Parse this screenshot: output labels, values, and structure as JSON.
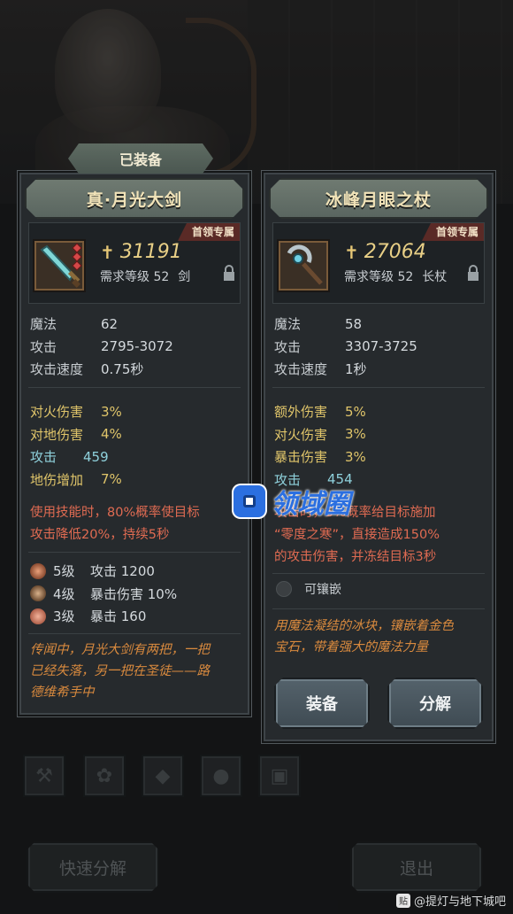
{
  "equipped_tab": "已装备",
  "left_item": {
    "title": "真·月光大剑",
    "boss_tag": "首领专属",
    "power": "31191",
    "req_level": "需求等级 52",
    "weapon_type": "剑",
    "base_stats": [
      {
        "key": "魔法",
        "value": "62"
      },
      {
        "key": "攻击",
        "value": "2795-3072"
      },
      {
        "key": "攻击速度",
        "value": "0.75秒"
      }
    ],
    "bonus_stats": [
      {
        "key": "对火伤害",
        "value": "3%"
      },
      {
        "key": "对地伤害",
        "value": "4%"
      }
    ],
    "cyan_stat": {
      "key": "攻击",
      "value": "459"
    },
    "extra_stat": {
      "key": "地伤增加",
      "value": "7%"
    },
    "skill_text_1": "使用技能时，80%概率使目标",
    "skill_text_2": "攻击降低20%，持续5秒",
    "gems": [
      {
        "level": "5级",
        "effect": "攻击 1200",
        "color": "#c9714f"
      },
      {
        "level": "4级",
        "effect": "暴击伤害 10%",
        "color": "#b08a6a"
      },
      {
        "level": "3级",
        "effect": "暴击 160",
        "color": "#d88c72"
      }
    ],
    "flavor_1": "传闻中，月光大剑有两把，一把",
    "flavor_2": "已经失落，另一把在圣徒——路",
    "flavor_3": "德维希手中"
  },
  "right_item": {
    "title": "冰峰月眼之杖",
    "boss_tag": "首领专属",
    "power": "27064",
    "req_level": "需求等级 52",
    "weapon_type": "长杖",
    "base_stats": [
      {
        "key": "魔法",
        "value": "58"
      },
      {
        "key": "攻击",
        "value": "3307-3725"
      },
      {
        "key": "攻击速度",
        "value": "1秒"
      }
    ],
    "bonus_stats": [
      {
        "key": "额外伤害",
        "value": "5%"
      },
      {
        "key": "对火伤害",
        "value": "3%"
      },
      {
        "key": "暴击伤害",
        "value": "3%"
      }
    ],
    "cyan_stat": {
      "key": "攻击",
      "value": "454"
    },
    "skill_text_1": "攻击时，5%概率给目标施加",
    "skill_text_2": "“零度之寒”，直接造成150%",
    "skill_text_3": "的攻击伤害，并冻结目标3秒",
    "socket_label": "可镶嵌",
    "flavor_1": "用魔法凝结的冰块，镶嵌着金色",
    "flavor_2": "宝石，带着强大的魔法力量",
    "equip_button": "装备",
    "dismantle_button": "分解"
  },
  "bottom": {
    "quick_dismantle": "快速分解",
    "exit": "退出"
  },
  "watermark": "领域圈",
  "credit": "@提灯与地下城吧"
}
